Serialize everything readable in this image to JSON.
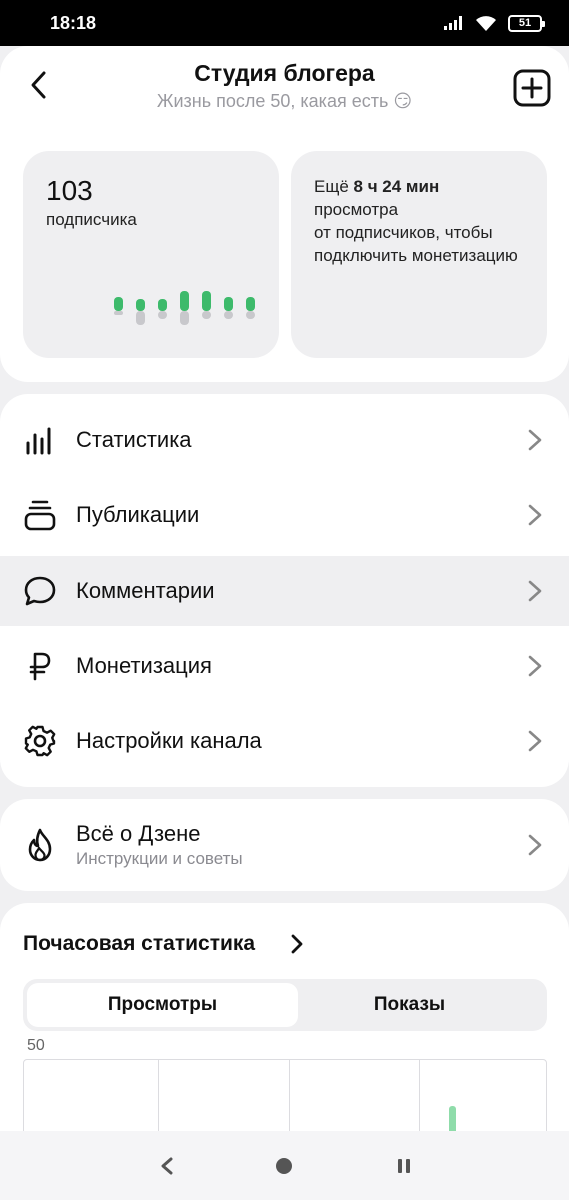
{
  "status": {
    "time": "18:18",
    "battery": "51"
  },
  "header": {
    "title": "Студия блогера",
    "subtitle": "Жизнь после 50, какая есть 😏"
  },
  "subscribers": {
    "count": "103",
    "label": "подписчика"
  },
  "monetization_info": {
    "prefix": "Ещё ",
    "time_left": "8 ч 24 мин",
    "rest": "просмотра\nот подписчиков, чтобы подключить монетизацию"
  },
  "menu": {
    "items": [
      {
        "label": "Статистика",
        "icon": "bar-chart-icon"
      },
      {
        "label": "Публикации",
        "icon": "stack-icon"
      },
      {
        "label": "Комментарии",
        "icon": "comment-bubble-icon"
      },
      {
        "label": "Монетизация",
        "icon": "ruble-icon"
      },
      {
        "label": "Настройки канала",
        "icon": "gear-icon"
      }
    ]
  },
  "zen": {
    "title": "Всё о Дзене",
    "subtitle": "Инструкции и советы",
    "icon": "flame-icon"
  },
  "hourly": {
    "title": "Почасовая статистика",
    "tabs": [
      "Просмотры",
      "Показы"
    ],
    "active_tab": "Просмотры",
    "y_max_label": "50"
  },
  "colors": {
    "accent_green": "#3dba6b",
    "card_bg": "#efeff1",
    "muted_text": "#9a9aa0"
  }
}
